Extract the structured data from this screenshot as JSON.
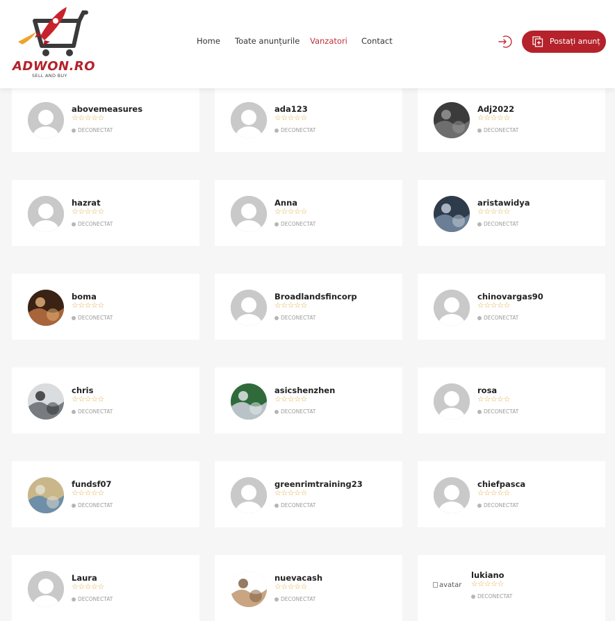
{
  "brand": {
    "logo_text": "ADWON.RO",
    "logo_subtext": "SELL AND BUY",
    "colors": {
      "primary": "#b5222b",
      "accent_orange": "#f0a22d",
      "cart": "#3a3a3a"
    }
  },
  "nav": {
    "items": [
      {
        "label": "Home",
        "active": false
      },
      {
        "label": "Toate anunțurile",
        "active": false
      },
      {
        "label": "Vanzatori",
        "active": true
      },
      {
        "label": "Contact",
        "active": false
      }
    ]
  },
  "header_actions": {
    "login_icon": "login-icon",
    "post_ad_label": "Postați anunț",
    "post_ad_icon": "add-document-icon"
  },
  "sellers": [
    {
      "username": "abovemeasures",
      "status": "DECONECTAT",
      "avatar": "default-avatar-icon",
      "rating_stars": 0
    },
    {
      "username": "ada123",
      "status": "DECONECTAT",
      "avatar": "default-avatar-icon",
      "rating_stars": 0
    },
    {
      "username": "Adj2022",
      "status": "DECONECTAT",
      "avatar": "map-photo",
      "rating_stars": 0
    },
    {
      "username": "hazrat",
      "status": "DECONECTAT",
      "avatar": "default-avatar-icon",
      "rating_stars": 0
    },
    {
      "username": "Anna",
      "status": "DECONECTAT",
      "avatar": "default-avatar-icon",
      "rating_stars": 0
    },
    {
      "username": "aristawidya",
      "status": "DECONECTAT",
      "avatar": "office-photo",
      "rating_stars": 0
    },
    {
      "username": "boma",
      "status": "DECONECTAT",
      "avatar": "coin-photo",
      "rating_stars": 0
    },
    {
      "username": "Broadlandsfincorp",
      "status": "DECONECTAT",
      "avatar": "default-avatar-icon",
      "rating_stars": 0
    },
    {
      "username": "chinovargas90",
      "status": "DECONECTAT",
      "avatar": "default-avatar-icon",
      "rating_stars": 0
    },
    {
      "username": "chris",
      "status": "DECONECTAT",
      "avatar": "bicycle-photo",
      "rating_stars": 0
    },
    {
      "username": "asicshenzhen",
      "status": "DECONECTAT",
      "avatar": "machines-photo",
      "rating_stars": 0
    },
    {
      "username": "rosa",
      "status": "DECONECTAT",
      "avatar": "default-avatar-icon",
      "rating_stars": 0
    },
    {
      "username": "fundsf07",
      "status": "DECONECTAT",
      "avatar": "money-photo",
      "rating_stars": 0
    },
    {
      "username": "greenrimtraining23",
      "status": "DECONECTAT",
      "avatar": "default-avatar-icon",
      "rating_stars": 0
    },
    {
      "username": "chiefpasca",
      "status": "DECONECTAT",
      "avatar": "default-avatar-icon",
      "rating_stars": 0
    },
    {
      "username": "Laura",
      "status": "DECONECTAT",
      "avatar": "default-avatar-icon",
      "rating_stars": 0
    },
    {
      "username": "nuevacash",
      "status": "DECONECTAT",
      "avatar": "person-photo",
      "rating_stars": 0
    },
    {
      "username": "lukiano",
      "status": "DECONECTAT",
      "avatar": "broken-image",
      "avatar_alt": "avatar",
      "rating_stars": 0
    }
  ],
  "star_glyph": "☆☆☆☆☆"
}
